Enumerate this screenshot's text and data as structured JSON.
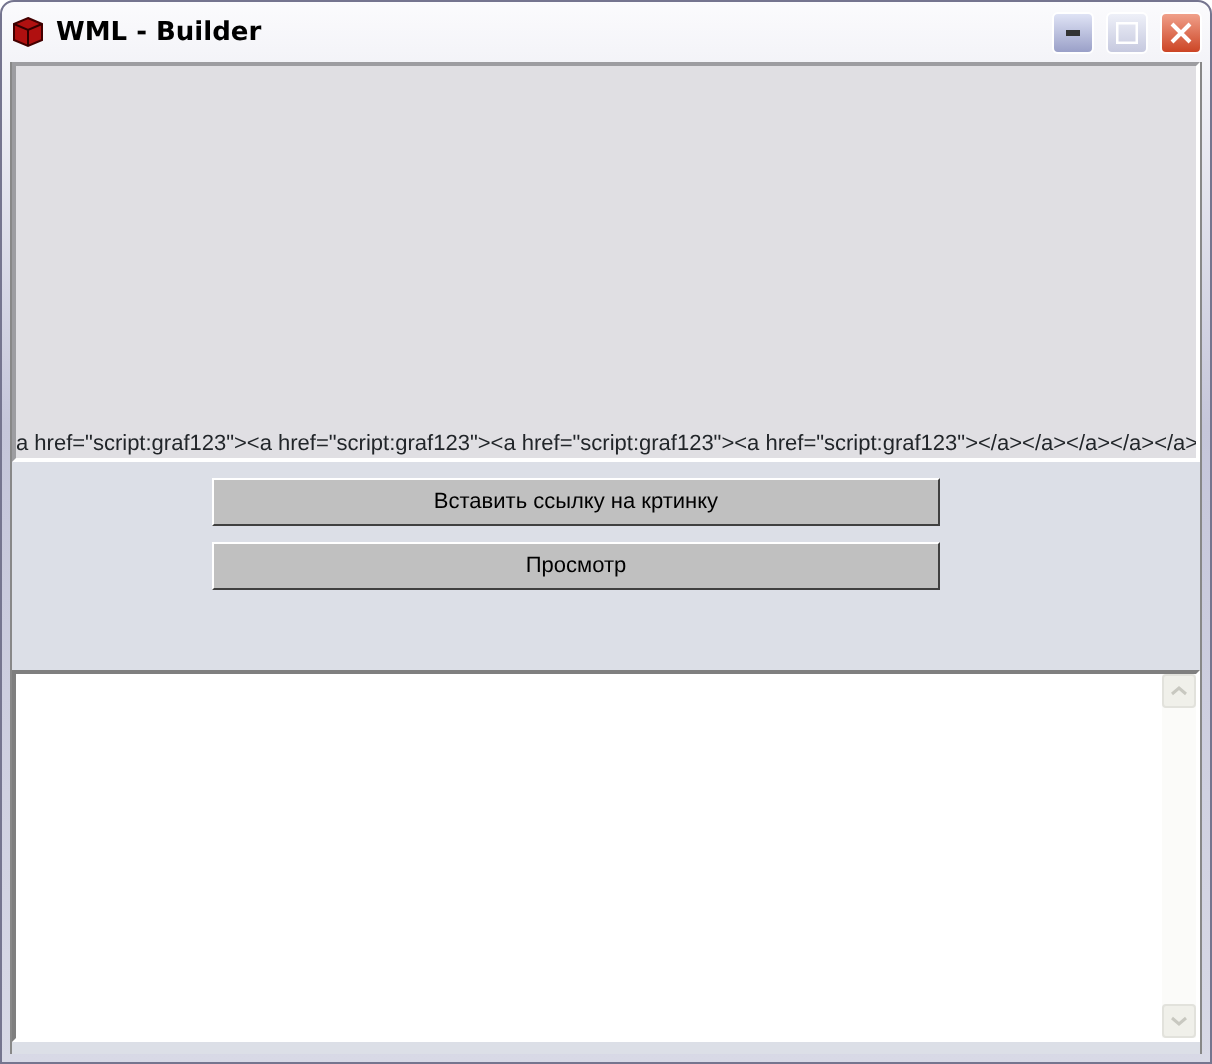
{
  "window": {
    "title": "WML - Builder"
  },
  "preview": {
    "text": "a href=\"script:graf123\"><a href=\"script:graf123\"><a href=\"script:graf123\"><a href=\"script:graf123\"></a></a></a></a></a>"
  },
  "buttons": [
    "Вставить ссылку на кртинку",
    "Просмотр"
  ]
}
